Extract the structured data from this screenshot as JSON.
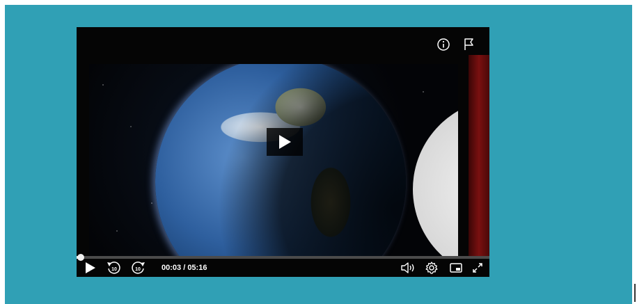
{
  "player": {
    "current_time": "00:03",
    "separator": " / ",
    "total_duration": "05:16",
    "progress_fraction": 0.01,
    "icons": {
      "info": "info-icon",
      "report": "flag-icon",
      "big_play": "play-icon",
      "play": "play-icon",
      "rewind": "rewind-10-icon",
      "forward": "forward-10-icon",
      "volume": "volume-icon",
      "settings": "gear-icon",
      "pip": "picture-in-picture-icon",
      "fullscreen": "fullscreen-icon"
    },
    "skip_seconds_label": "10"
  },
  "colors": {
    "page_background": "#30a0b5",
    "player_background": "#050505",
    "control_icon": "#ffffff",
    "progress_track": "#4b4b4b",
    "progress_fill": "#e6e6e6"
  }
}
